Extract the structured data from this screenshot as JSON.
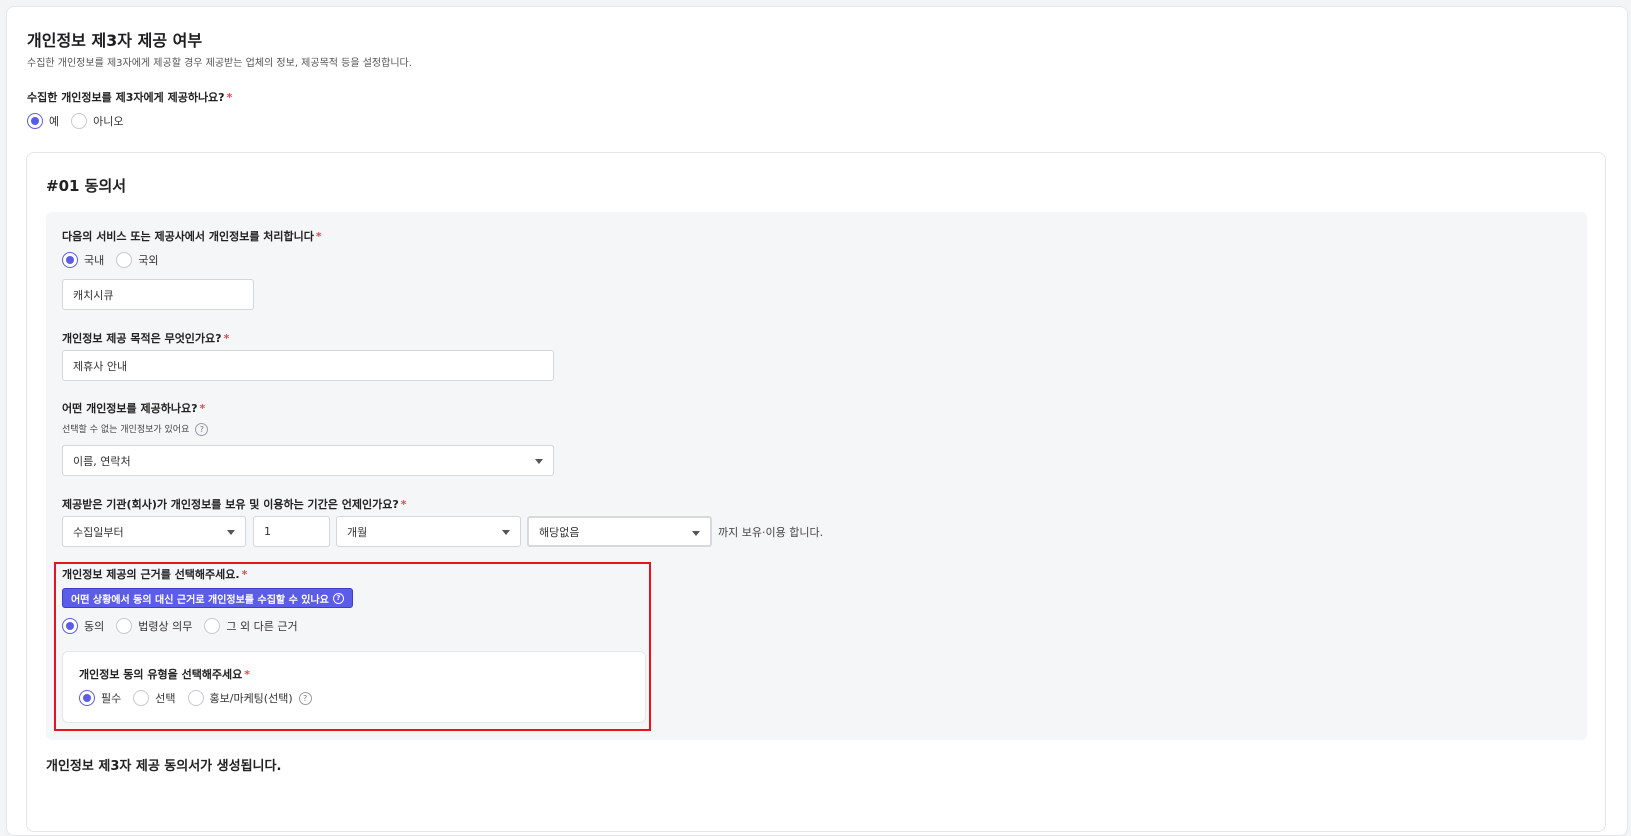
{
  "header": {
    "title": "개인정보 제3자 제공 여부",
    "description": "수집한 개인정보를 제3자에게 제공할 경우 제공받는 업체의 정보, 제공목적 등을 설정합니다."
  },
  "provide_question": {
    "label": "수집한 개인정보를 제3자에게 제공하나요?",
    "required_mark": "*",
    "options": [
      "예",
      "아니오"
    ],
    "selected": "예"
  },
  "consent": {
    "title": "#01 동의서",
    "processor": {
      "label": "다음의 서비스 또는 제공사에서 개인정보를 처리합니다",
      "options": [
        "국내",
        "국외"
      ],
      "selected": "국내",
      "value": "캐치시큐"
    },
    "purpose": {
      "label": "개인정보 제공 목적은 무엇인가요?",
      "value": "제휴사 안내"
    },
    "info_items": {
      "label": "어떤 개인정보를 제공하나요?",
      "hint": "선택할 수 없는 개인정보가 있어요",
      "value": "이름, 연락처"
    },
    "retention": {
      "label": "제공받은 기관(회사)가 개인정보를 보유 및 이용하는 기간은 언제인가요?",
      "start": "수집일부터",
      "amount": "1",
      "unit": "개월",
      "exception": "해당없음",
      "suffix": "까지 보유·이용 합니다."
    },
    "basis": {
      "label": "개인정보 제공의 근거를 선택해주세요.",
      "help_button": "어떤 상황에서 동의 대신 근거로 개인정보를 수집할 수 있나요",
      "options": [
        "동의",
        "법령상 의무",
        "그 외 다른 근거"
      ],
      "selected": "동의"
    },
    "consent_type": {
      "label": "개인정보 동의 유형을 선택해주세요",
      "options": [
        "필수",
        "선택",
        "홍보/마케팅(선택)"
      ],
      "selected": "필수"
    },
    "footer": "개인정보 제3자 제공 동의서가 생성됩니다."
  },
  "icons": {
    "help": "question-circle-icon",
    "dropdown": "chevron-down-icon"
  },
  "colors": {
    "accent": "#5b5ce8",
    "required": "#e5484d",
    "highlight": "#e8131b"
  }
}
